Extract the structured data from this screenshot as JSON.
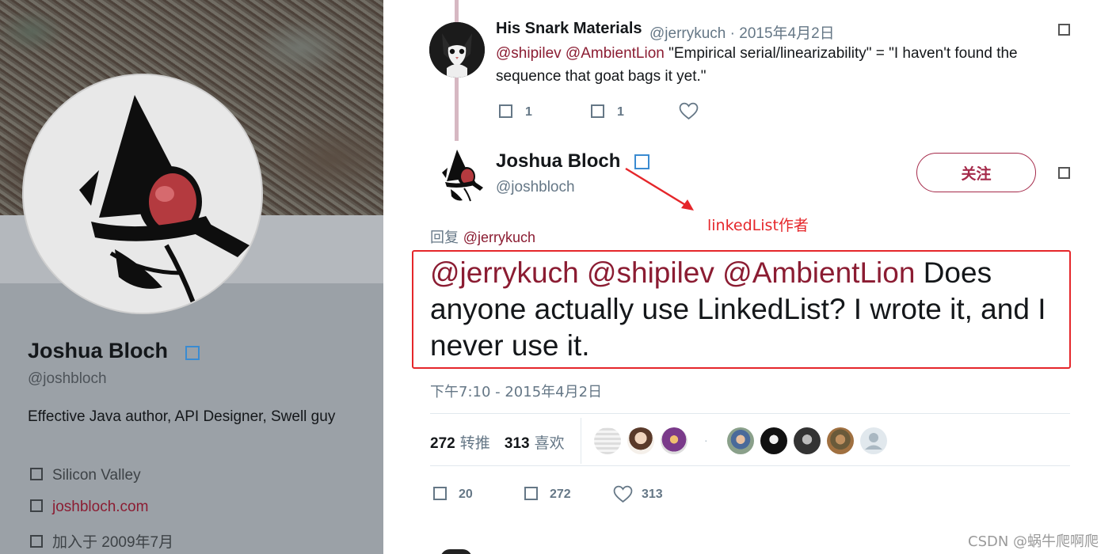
{
  "profile": {
    "name": "Joshua Bloch",
    "handle": "@joshbloch",
    "bio": "Effective Java author, API Designer, Swell guy",
    "location": "Silicon Valley",
    "website": "joshbloch.com",
    "joined": "加入于 2009年7月"
  },
  "parent_tweet": {
    "name": "His Snark Materials",
    "handle_date": "@jerrykuch · 2015年4月2日",
    "mentions": "@shipilev @AmbientLion",
    "text": " \"Empirical serial/linearizability\" = \"I haven't found the sequence that goat bags it yet.\"",
    "replies": "1",
    "retweets": "1"
  },
  "main_tweet": {
    "name": "Joshua Bloch",
    "handle": "@joshbloch",
    "follow_label": "关注",
    "reply_prefix": "回复",
    "reply_to": "@jerrykuch",
    "mentions": "@jerrykuch @shipilev @AmbientLion",
    "text": " Does anyone actually use LinkedList?  I wrote it, and I never use it.",
    "timestamp": "下午7:10 - 2015年4月2日",
    "retweet_count": "272",
    "retweet_label": "转推",
    "like_count": "313",
    "like_label": "喜欢",
    "actions": {
      "replies": "20",
      "retweets": "272",
      "likes": "313"
    }
  },
  "annotation": {
    "text": "linkedList作者",
    "color": "#e5262a"
  },
  "watermark": "CSDN @蜗牛爬啊爬",
  "colors": {
    "accent": "#8b1c32",
    "verified": "#3a8bd1",
    "secondary_text": "#657786"
  }
}
